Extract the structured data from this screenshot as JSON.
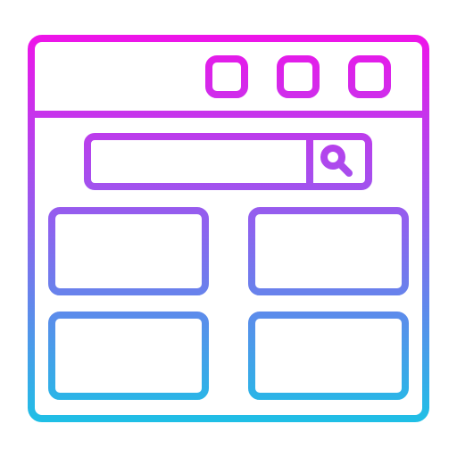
{
  "icon": {
    "name": "browser-window-search-grid-icon",
    "style": "gradient-outline",
    "gradient": {
      "top": "#ee14e9",
      "middle": "#8d63ef",
      "bottom": "#1fbfe6"
    },
    "window_controls": [
      "control-1",
      "control-2",
      "control-3"
    ],
    "search_bar": {
      "icon": "search-icon",
      "value": ""
    },
    "content_cards": [
      "card-1",
      "card-2",
      "card-3",
      "card-4"
    ]
  }
}
